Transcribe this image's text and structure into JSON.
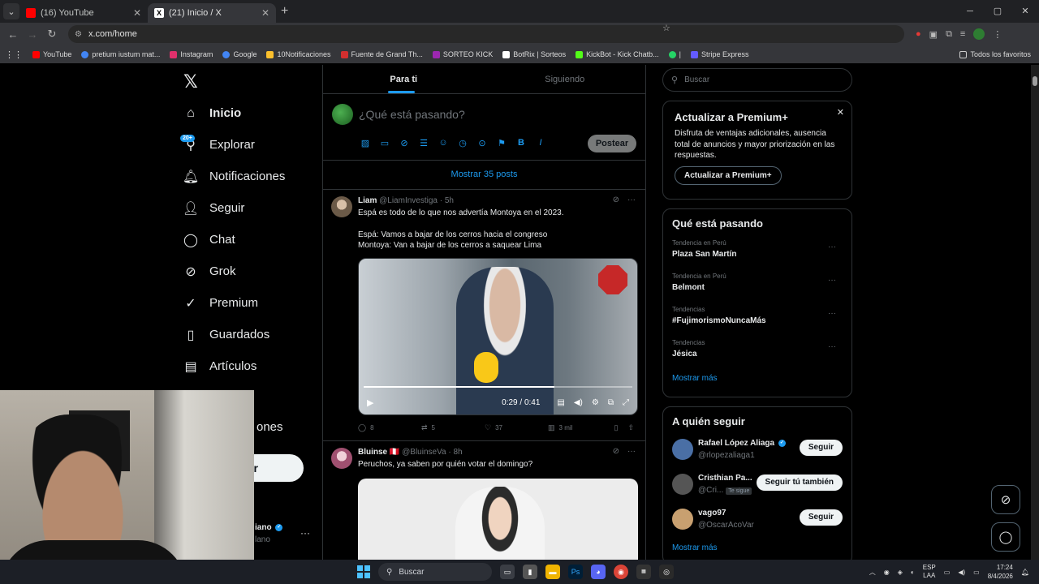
{
  "browser": {
    "tabs": [
      {
        "title": "(16) YouTube",
        "active": false,
        "favicon_color": "#ff0000"
      },
      {
        "title": "(21) Inicio / X",
        "active": true,
        "favicon_color": "#ffffff"
      }
    ],
    "url": "x.com/home",
    "bookmarks": [
      {
        "label": "YouTube",
        "icon_color": "#ff0000"
      },
      {
        "label": "pretium iustum mat...",
        "icon_color": "#4285f4"
      },
      {
        "label": "Instagram",
        "icon_color": "#e1306c"
      },
      {
        "label": "Google",
        "icon_color": "#4285f4"
      },
      {
        "label": "10Notificaciones",
        "icon_color": "#ffffff"
      },
      {
        "label": "Fuente de Grand Th...",
        "icon_color": "#d32f2f"
      },
      {
        "label": "SORTEO KICK",
        "icon_color": "#9c27b0"
      },
      {
        "label": "BotRix | Sorteos",
        "icon_color": "#ffffff"
      },
      {
        "label": "KickBot - Kick Chatb...",
        "icon_color": "#53fc18"
      },
      {
        "label": "|",
        "icon_color": "#25d366"
      },
      {
        "label": "Stripe Express",
        "icon_color": "#635bff"
      }
    ],
    "all_favorites": "Todos los favoritos"
  },
  "nav": {
    "items": [
      {
        "label": "Inicio",
        "icon": "home-icon",
        "glyph": "⌂"
      },
      {
        "label": "Explorar",
        "icon": "search-icon",
        "glyph": "⚲"
      },
      {
        "label": "Notificaciones",
        "icon": "bell-icon",
        "glyph": "🔔︎",
        "badge": "20+"
      },
      {
        "label": "Seguir",
        "icon": "person-add-icon",
        "glyph": "👤︎"
      },
      {
        "label": "Chat",
        "icon": "chat-icon",
        "glyph": "◯"
      },
      {
        "label": "Grok",
        "icon": "grok-icon",
        "glyph": "⊘"
      },
      {
        "label": "Premium",
        "icon": "premium-icon",
        "glyph": "✓"
      },
      {
        "label": "Guardados",
        "icon": "bookmark-icon",
        "glyph": "▯"
      },
      {
        "label": "Artículos",
        "icon": "article-icon",
        "glyph": "▤"
      }
    ],
    "partial_label": "ones",
    "post_button": "r",
    "account_name": "iano",
    "account_handle": "lano"
  },
  "timeline": {
    "tabs": [
      "Para ti",
      "Siguiendo"
    ],
    "composer_placeholder": "¿Qué está pasando?",
    "post_button": "Postear",
    "show_more": "Mostrar 35 posts",
    "tweets": [
      {
        "name": "Liam",
        "handle": "@LiamInvestiga",
        "time": "· 5h",
        "text": [
          "Espá es todo de lo que nos advertía Montoya en el 2023.",
          "Espá: Vamos a bajar de los cerros hacia el congreso\nMontoya: Van a bajar de los cerros a saquear Lima"
        ],
        "video_time": "0:29 / 0:41",
        "video_progress": 0.71,
        "replies": "8",
        "reposts": "5",
        "likes": "37",
        "views": "3 mil"
      },
      {
        "name": "Bluinse",
        "flag": "🇵🇪",
        "handle": "@BluinseVa",
        "time": "· 8h",
        "text": [
          "Peruchos, ya saben por quién votar el domingo?"
        ]
      }
    ]
  },
  "sidebar": {
    "search_placeholder": "Buscar",
    "premium": {
      "title": "Actualizar a Premium+",
      "body": "Disfruta de ventajas adicionales, ausencia total de anuncios y mayor priorización en las respuestas.",
      "button": "Actualizar a Premium+"
    },
    "trends_title": "Qué está pasando",
    "trends": [
      {
        "context": "Tendencia en Perú",
        "name": "Plaza San Martín"
      },
      {
        "context": "Tendencia en Perú",
        "name": "Belmont"
      },
      {
        "context": "Tendencias",
        "name": "#FujimorismoNuncaMás"
      },
      {
        "context": "Tendencias",
        "name": "Jésica"
      }
    ],
    "trends_more": "Mostrar más",
    "follow_title": "A quién seguir",
    "follow": [
      {
        "name": "Rafael López Aliaga",
        "handle": "@rlopezaliaga1",
        "button": "Seguir",
        "verified": true,
        "avatar_color": "#4a6fa5"
      },
      {
        "name": "Cristhian Pa...",
        "handle": "@Cri...",
        "tag": "Te sigue",
        "button": "Seguir tú también",
        "verified": false,
        "avatar_color": "#555555"
      },
      {
        "name": "vago97",
        "handle": "@OscarAcoVar",
        "button": "Seguir",
        "verified": false,
        "avatar_color": "#c8a070"
      }
    ],
    "follow_more": "Mostrar más"
  },
  "taskbar": {
    "search": "Buscar",
    "lang": [
      "ESP",
      "LAA"
    ],
    "time": "17:24",
    "date": "8/4/2026"
  }
}
